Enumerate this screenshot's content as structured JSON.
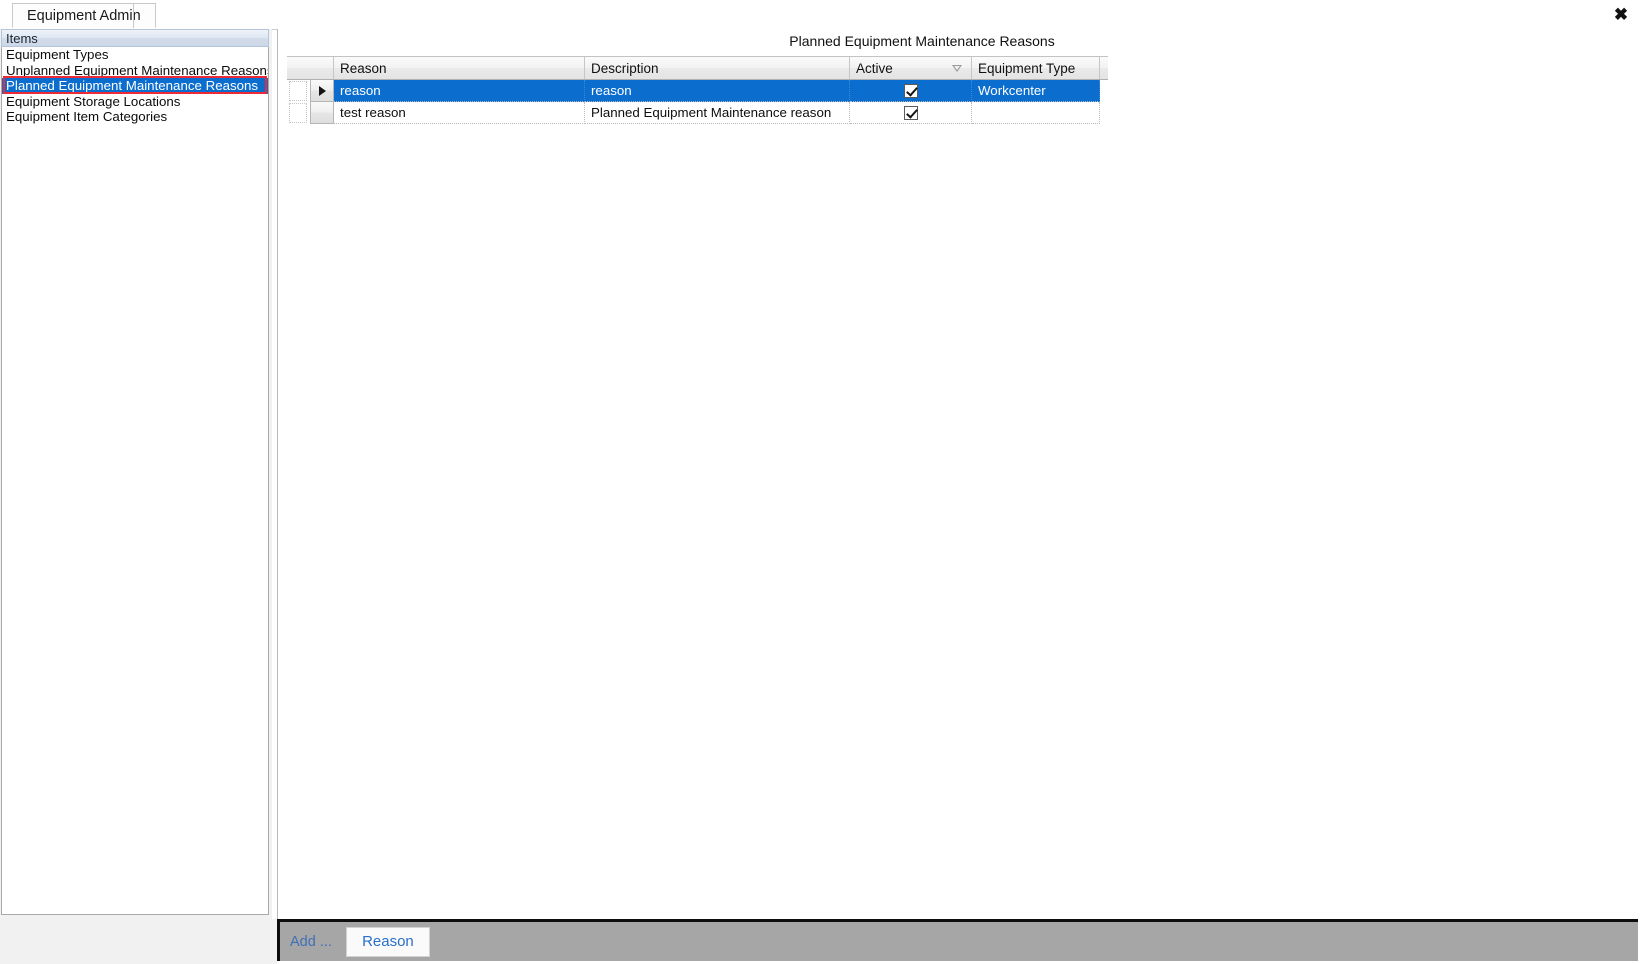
{
  "window": {
    "close_icon": "close-x-icon",
    "close_label": "✖"
  },
  "tabs": [
    {
      "label": "Equipment Admin",
      "active": true
    }
  ],
  "sidebar": {
    "header": "Items",
    "items": [
      {
        "label": "Equipment Types",
        "selected": false
      },
      {
        "label": "Unplanned Equipment Maintenance Reasons",
        "selected": false
      },
      {
        "label": "Planned Equipment Maintenance Reasons",
        "selected": true
      },
      {
        "label": "Equipment Storage Locations",
        "selected": false
      },
      {
        "label": "Equipment Item Categories",
        "selected": false
      }
    ]
  },
  "main": {
    "title": "Planned Equipment Maintenance Reasons",
    "grid": {
      "columns": [
        {
          "key": "rowhdr",
          "label": ""
        },
        {
          "key": "reason",
          "label": "Reason"
        },
        {
          "key": "description",
          "label": "Description"
        },
        {
          "key": "active",
          "label": "Active",
          "sort": "descending"
        },
        {
          "key": "equipment_type",
          "label": "Equipment Type"
        }
      ],
      "rows": [
        {
          "selected": true,
          "reason": "reason",
          "description": "reason",
          "active": true,
          "equipment_type": "Workcenter"
        },
        {
          "selected": false,
          "reason": "test reason",
          "description": "Planned Equipment Maintenance reason",
          "active": true,
          "equipment_type": ""
        }
      ]
    }
  },
  "bottom_bar": {
    "add_label": "Add ...",
    "reason_button": "Reason"
  },
  "colors": {
    "selection_blue": "#0b6ecf",
    "annotation_red": "#ee2b34",
    "bottom_bar_gray": "#a6a6a6",
    "link_blue": "#2a6fc9"
  }
}
